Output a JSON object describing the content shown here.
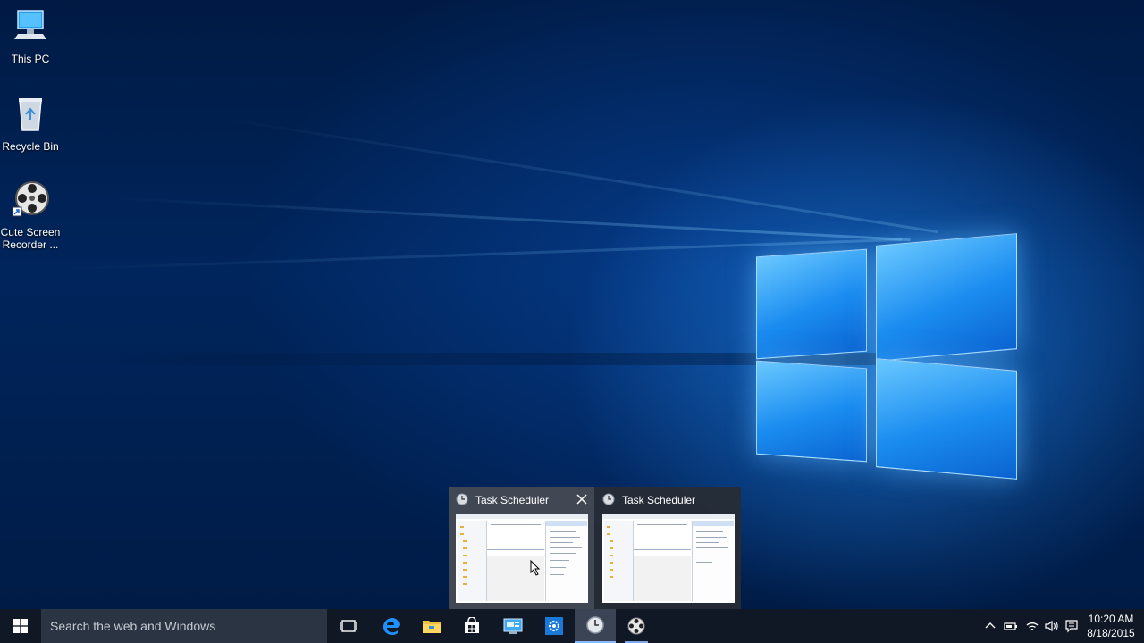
{
  "desktop": {
    "icons": [
      {
        "label": "This PC"
      },
      {
        "label": "Recycle Bin"
      },
      {
        "label_line1": "Cute Screen",
        "label_line2": "Recorder ..."
      }
    ]
  },
  "taskbar": {
    "search_placeholder": "Search the web and Windows",
    "apps": [
      {
        "name": "Task View",
        "icon": "task-view-icon"
      },
      {
        "name": "Microsoft Edge",
        "icon": "edge-icon"
      },
      {
        "name": "File Explorer",
        "icon": "folder-icon"
      },
      {
        "name": "Store",
        "icon": "store-icon"
      },
      {
        "name": "Control Panel",
        "icon": "control-panel-icon"
      },
      {
        "name": "Settings",
        "icon": "gear-icon"
      },
      {
        "name": "Task Scheduler",
        "icon": "clock-icon"
      },
      {
        "name": "Cute Screen Recorder",
        "icon": "film-reel-icon"
      }
    ],
    "clock": {
      "time": "10:20 AM",
      "date": "8/18/2015"
    }
  },
  "thumbnails": [
    {
      "title": "Task Scheduler"
    },
    {
      "title": "Task Scheduler"
    }
  ],
  "colors": {
    "accent": "#1a8cf0",
    "taskbar": "#101826"
  }
}
